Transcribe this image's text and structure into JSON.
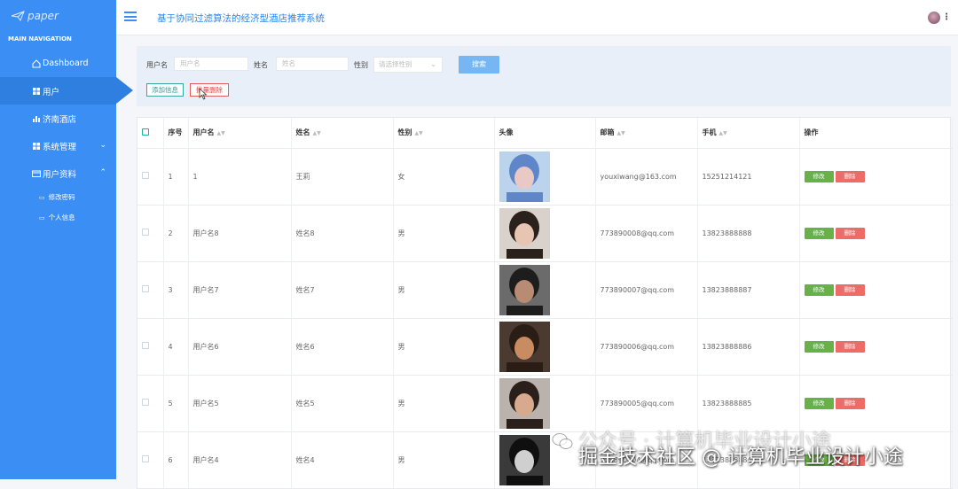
{
  "sidebar": {
    "logo_text": "paper",
    "section_title": "MAIN NAVIGATION",
    "items": [
      {
        "label": "Dashboard"
      },
      {
        "label": "用户"
      },
      {
        "label": "济南酒店"
      },
      {
        "label": "系统管理"
      },
      {
        "label": "用户资料"
      }
    ],
    "sub_items": [
      {
        "label": "修改密码"
      },
      {
        "label": "个人信息"
      }
    ]
  },
  "header": {
    "title": "基于协同过滤算法的经济型酒店推荐系统"
  },
  "search": {
    "username_label": "用户名",
    "username_placeholder": "用户名",
    "name_label": "姓名",
    "name_placeholder": "姓名",
    "gender_label": "性别",
    "gender_placeholder": "请选择性别",
    "search_button": "搜索",
    "add_button": "添加信息",
    "batch_delete_button": "批量删除"
  },
  "table": {
    "columns": [
      "序号",
      "用户名",
      "姓名",
      "性别",
      "头像",
      "邮箱",
      "手机",
      "操作"
    ],
    "edit_label": "修改",
    "delete_label": "删除",
    "rows": [
      {
        "no": "1",
        "username": "1",
        "name": "王莉",
        "gender": "女",
        "email": "youxiwang@163.com",
        "phone": "15251214121"
      },
      {
        "no": "2",
        "username": "用户名8",
        "name": "姓名8",
        "gender": "男",
        "email": "773890008@qq.com",
        "phone": "13823888888"
      },
      {
        "no": "3",
        "username": "用户名7",
        "name": "姓名7",
        "gender": "男",
        "email": "773890007@qq.com",
        "phone": "13823888887"
      },
      {
        "no": "4",
        "username": "用户名6",
        "name": "姓名6",
        "gender": "男",
        "email": "773890006@qq.com",
        "phone": "13823888886"
      },
      {
        "no": "5",
        "username": "用户名5",
        "name": "姓名5",
        "gender": "男",
        "email": "773890005@qq.com",
        "phone": "13823888885"
      },
      {
        "no": "6",
        "username": "用户名4",
        "name": "姓名4",
        "gender": "男",
        "email": "773890004@qq.com",
        "phone": "13823888884"
      }
    ]
  },
  "watermark": {
    "line1": "公众号 · 计算机毕业设计小途",
    "line2": "掘金技术社区 @ 计算机毕业设计小途"
  },
  "colors": {
    "sidebar": "#3a8ef4",
    "accent": "#2b86e8",
    "edit": "#6ab048",
    "delete": "#ee6b6b"
  }
}
